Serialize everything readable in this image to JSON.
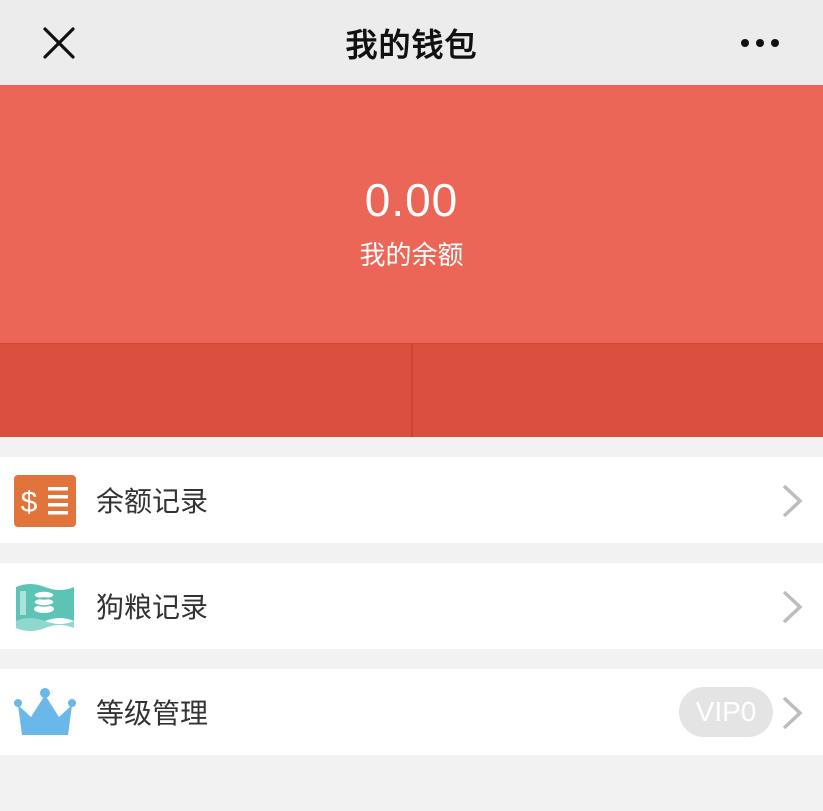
{
  "navbar": {
    "title": "我的钱包",
    "close_icon": "close-icon",
    "more_icon": "more-dots-icon"
  },
  "balance": {
    "amount": "0.00",
    "label": "我的余额",
    "bg_color": "#eb6656",
    "action_bg_color": "#db4f3f"
  },
  "menu": {
    "items": [
      {
        "label": "余额记录",
        "icon": "balance-record-icon",
        "icon_color": "#e0743a"
      },
      {
        "label": "狗粮记录",
        "icon": "money-bill-icon",
        "icon_color": "#5bc4b5"
      },
      {
        "label": "等级管理",
        "icon": "crown-icon",
        "icon_color": "#6ab7ea",
        "badge": "VIP0"
      }
    ]
  }
}
